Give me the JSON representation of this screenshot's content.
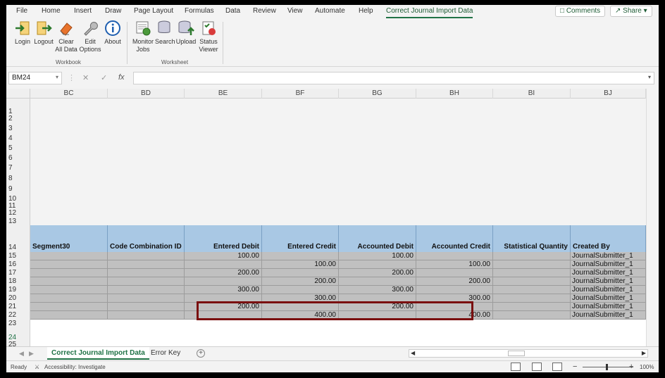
{
  "menu": {
    "tabs": [
      "File",
      "Home",
      "Insert",
      "Draw",
      "Page Layout",
      "Formulas",
      "Data",
      "Review",
      "View",
      "Automate",
      "Help",
      "Correct Journal Import Data"
    ],
    "comments_label": "Comments",
    "share_label": "Share"
  },
  "ribbon": {
    "workbook": {
      "label": "Workbook",
      "buttons": [
        {
          "label": "Login",
          "icon": "login-icon"
        },
        {
          "label": "Logout",
          "icon": "logout-icon"
        },
        {
          "label1": "Clear",
          "label2": "All Data",
          "icon": "eraser-icon"
        },
        {
          "label1": "Edit",
          "label2": "Options",
          "icon": "wrench-icon"
        },
        {
          "label": "About",
          "icon": "info-icon"
        }
      ]
    },
    "worksheet": {
      "label": "Worksheet",
      "buttons": [
        {
          "label1": "Monitor",
          "label2": "Jobs",
          "icon": "monitor-jobs-icon"
        },
        {
          "label": "Search",
          "icon": "database-search-icon"
        },
        {
          "label": "Upload",
          "icon": "database-upload-icon"
        },
        {
          "label1": "Status",
          "label2": "Viewer",
          "icon": "status-viewer-icon"
        }
      ]
    }
  },
  "formula_bar": {
    "name_box": "BM24",
    "cancel": "✕",
    "enter": "✓",
    "fx": "fx",
    "value": ""
  },
  "columns": [
    "BC",
    "BD",
    "BE",
    "BF",
    "BG",
    "BH",
    "BI",
    "BJ"
  ],
  "rows_blank": [
    "1",
    "2",
    "3",
    "4",
    "5",
    "6",
    "7",
    "8",
    "9",
    "10",
    "11",
    "12",
    "13"
  ],
  "table": {
    "header_row": "14",
    "headers": [
      "Segment30",
      "Code Combination ID",
      "Entered Debit",
      "Entered Credit",
      "Accounted Debit",
      "Accounted Credit",
      "Statistical Quantity",
      "Created By"
    ],
    "rows": [
      {
        "row": "15",
        "cells": [
          "",
          "",
          "100.00",
          "",
          "100.00",
          "",
          "",
          "JournalSubmitter_1"
        ]
      },
      {
        "row": "16",
        "cells": [
          "",
          "",
          "",
          "100.00",
          "",
          "100.00",
          "",
          "JournalSubmitter_1"
        ]
      },
      {
        "row": "17",
        "cells": [
          "",
          "",
          "200.00",
          "",
          "200.00",
          "",
          "",
          "JournalSubmitter_1"
        ]
      },
      {
        "row": "18",
        "cells": [
          "",
          "",
          "",
          "200.00",
          "",
          "200.00",
          "",
          "JournalSubmitter_1"
        ]
      },
      {
        "row": "19",
        "cells": [
          "",
          "",
          "300.00",
          "",
          "300.00",
          "",
          "",
          "JournalSubmitter_1"
        ]
      },
      {
        "row": "20",
        "cells": [
          "",
          "",
          "",
          "300.00",
          "",
          "300.00",
          "",
          "JournalSubmitter_1"
        ]
      },
      {
        "row": "21",
        "cells": [
          "",
          "",
          "200.00",
          "",
          "200.00",
          "",
          "",
          "JournalSubmitter_1"
        ]
      },
      {
        "row": "22",
        "cells": [
          "",
          "",
          "",
          "400.00",
          "",
          "400.00",
          "",
          "JournalSubmitter_1"
        ]
      }
    ]
  },
  "rows_after": [
    "23",
    "24",
    "25"
  ],
  "sheet_tabs": {
    "active": "Correct Journal Import Data",
    "other": "Error Key"
  },
  "status": {
    "ready": "Ready",
    "accessibility": "Accessibility: Investigate",
    "zoom": "100%"
  },
  "colors": {
    "accent": "#217346",
    "header_fill": "#a9c8e4",
    "row_fill": "#c0c0c0",
    "highlight_border": "#7a1010"
  }
}
